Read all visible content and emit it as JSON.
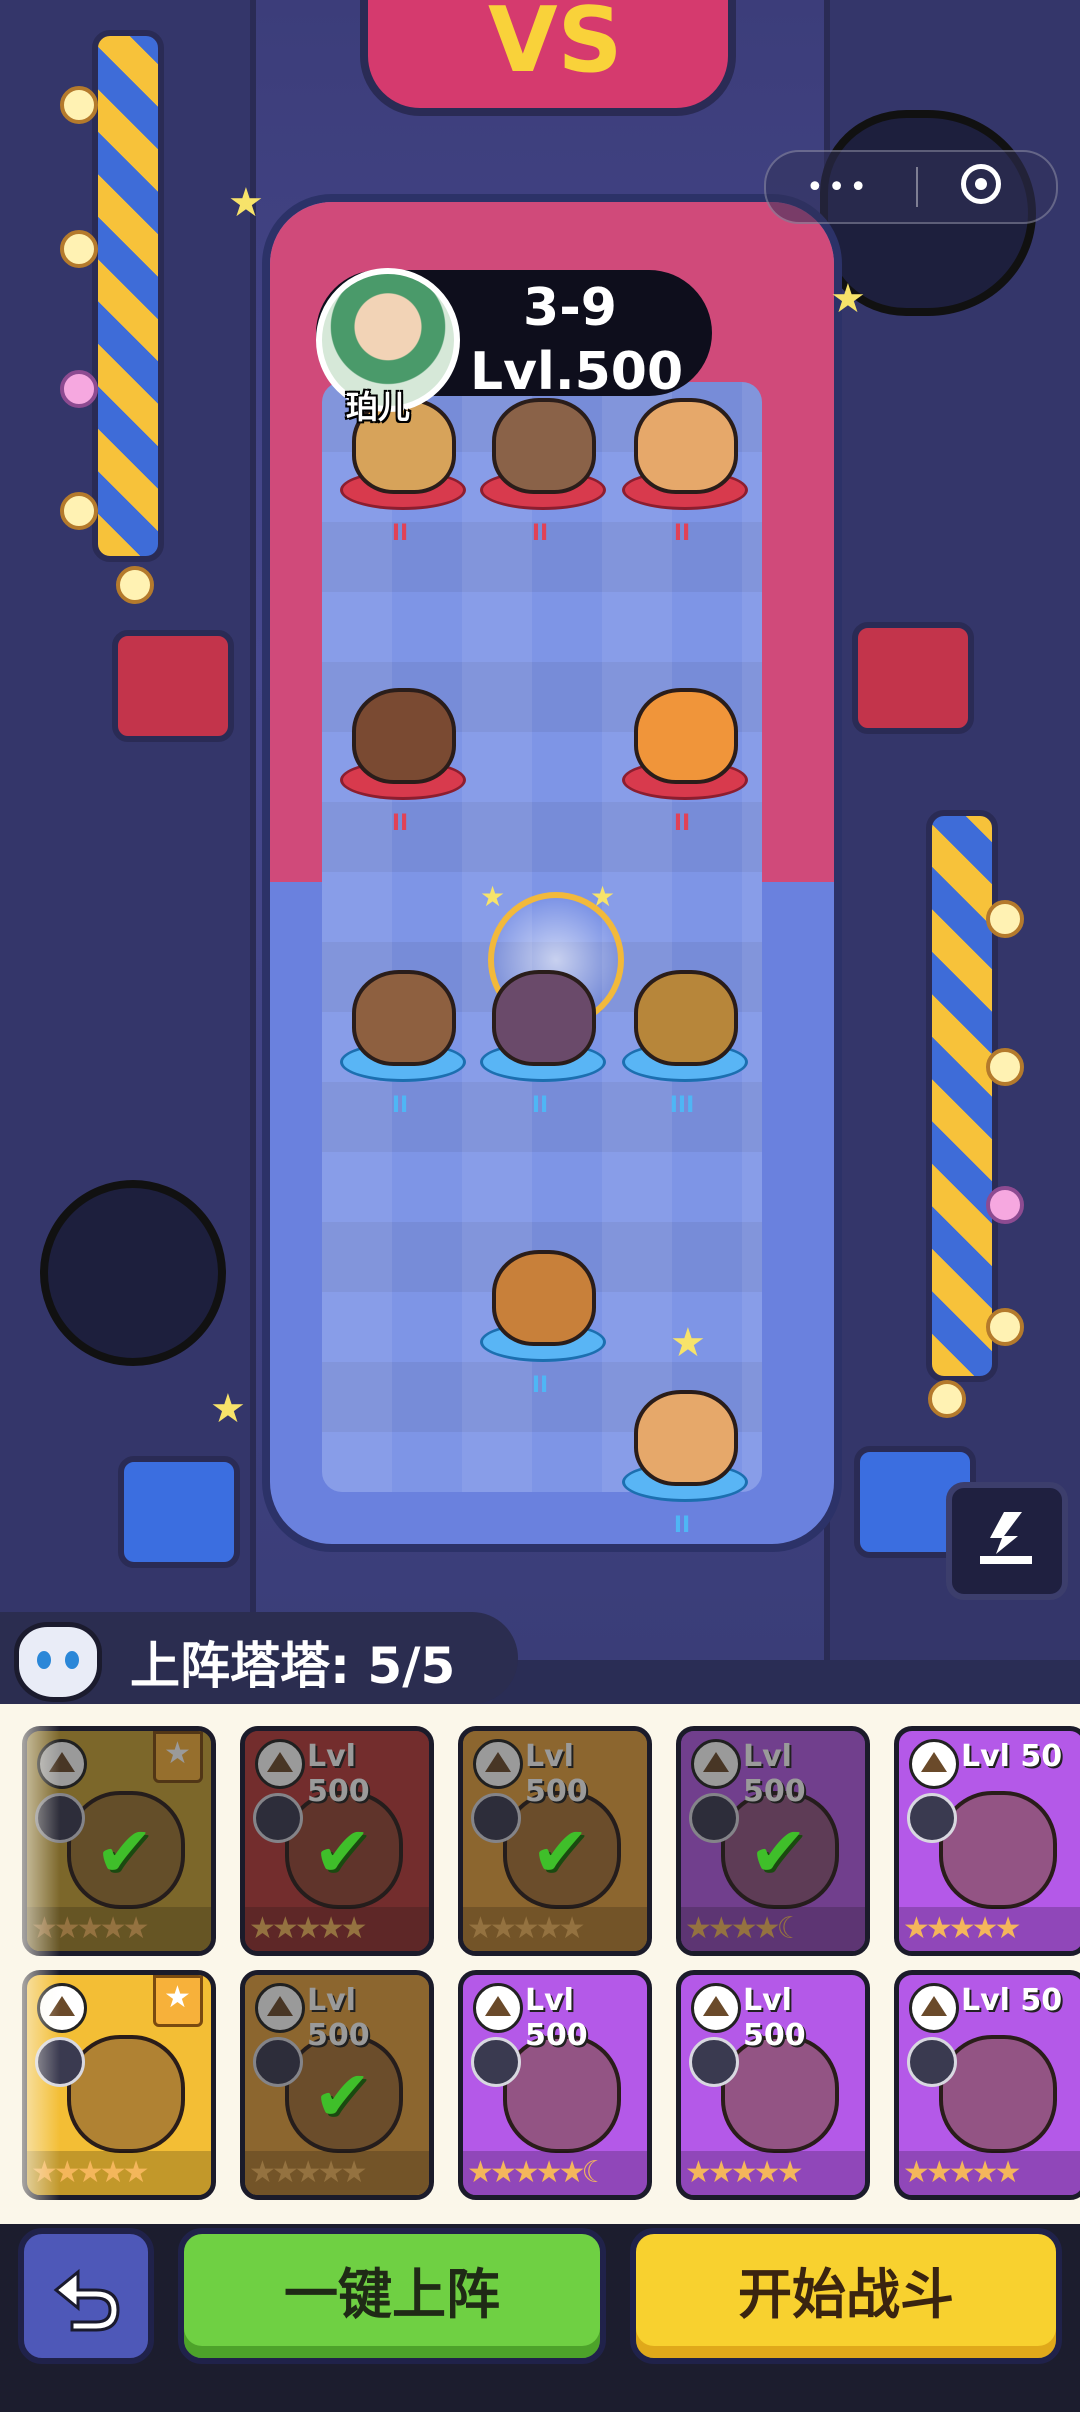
{
  "opponent": {
    "name": "珀儿",
    "stage": "3-9",
    "level": "Lvl.500"
  },
  "board": {
    "enemy_units": [
      {
        "name": "hamster-on-cookie",
        "rank": "II",
        "color": "#d7a35a"
      },
      {
        "name": "raccoon-knife",
        "rank": "II",
        "color": "#8a6248"
      },
      {
        "name": "snake",
        "rank": "II",
        "color": "#e6a86a"
      },
      {
        "name": "bear-boxer",
        "rank": "II",
        "color": "#7a4a32"
      },
      {
        "name": "kangaroo-boxer",
        "rank": "II",
        "color": "#f0953a"
      }
    ],
    "ally_units": [
      {
        "name": "guinea-pig",
        "rank": "II",
        "color": "#8e6040"
      },
      {
        "name": "purple-lizard",
        "rank": "II",
        "color": "#6a4a6a"
      },
      {
        "name": "pangolin",
        "rank": "III",
        "color": "#b7863a"
      },
      {
        "name": "fox-sunglasses",
        "rank": "II",
        "color": "#c8803a"
      },
      {
        "name": "snake",
        "rank": "II",
        "color": "#e6a86a"
      }
    ]
  },
  "panel": {
    "title": "上阵塔塔: 5/5"
  },
  "cards": [
    {
      "level": "",
      "bg": "c-olive",
      "selected": true,
      "starred": true,
      "stars": "★★★★★"
    },
    {
      "level": "Lvl 500",
      "bg": "c-red",
      "selected": true,
      "starred": false,
      "stars": "★★★★★"
    },
    {
      "level": "Lvl 500",
      "bg": "c-orange",
      "selected": true,
      "starred": false,
      "stars": "★★★★★"
    },
    {
      "level": "Lvl 500",
      "bg": "c-purple",
      "selected": true,
      "starred": false,
      "stars": "★★★★☾"
    },
    {
      "level": "Lvl 50",
      "bg": "c-purple",
      "selected": false,
      "starred": false,
      "stars": "★★★★★"
    },
    {
      "level": "",
      "bg": "c-gold",
      "selected": false,
      "starred": true,
      "stars": "★★★★★"
    },
    {
      "level": "Lvl 500",
      "bg": "c-orange",
      "selected": true,
      "starred": false,
      "stars": "★★★★★"
    },
    {
      "level": "Lvl 500",
      "bg": "c-purple",
      "selected": false,
      "starred": false,
      "stars": "★★★★★☾"
    },
    {
      "level": "Lvl 500",
      "bg": "c-purple",
      "selected": false,
      "starred": false,
      "stars": "★★★★★"
    },
    {
      "level": "Lvl 50",
      "bg": "c-purple",
      "selected": false,
      "starred": false,
      "stars": "★★★★★"
    }
  ],
  "buttons": {
    "one_click_deploy": "一键上阵",
    "start_battle": "开始战斗"
  },
  "icons": {
    "menu": "more-dots-icon",
    "target": "target-icon",
    "download": "download-icon",
    "back": "back-arrow-icon",
    "mascot": "cat-mascot-icon"
  }
}
